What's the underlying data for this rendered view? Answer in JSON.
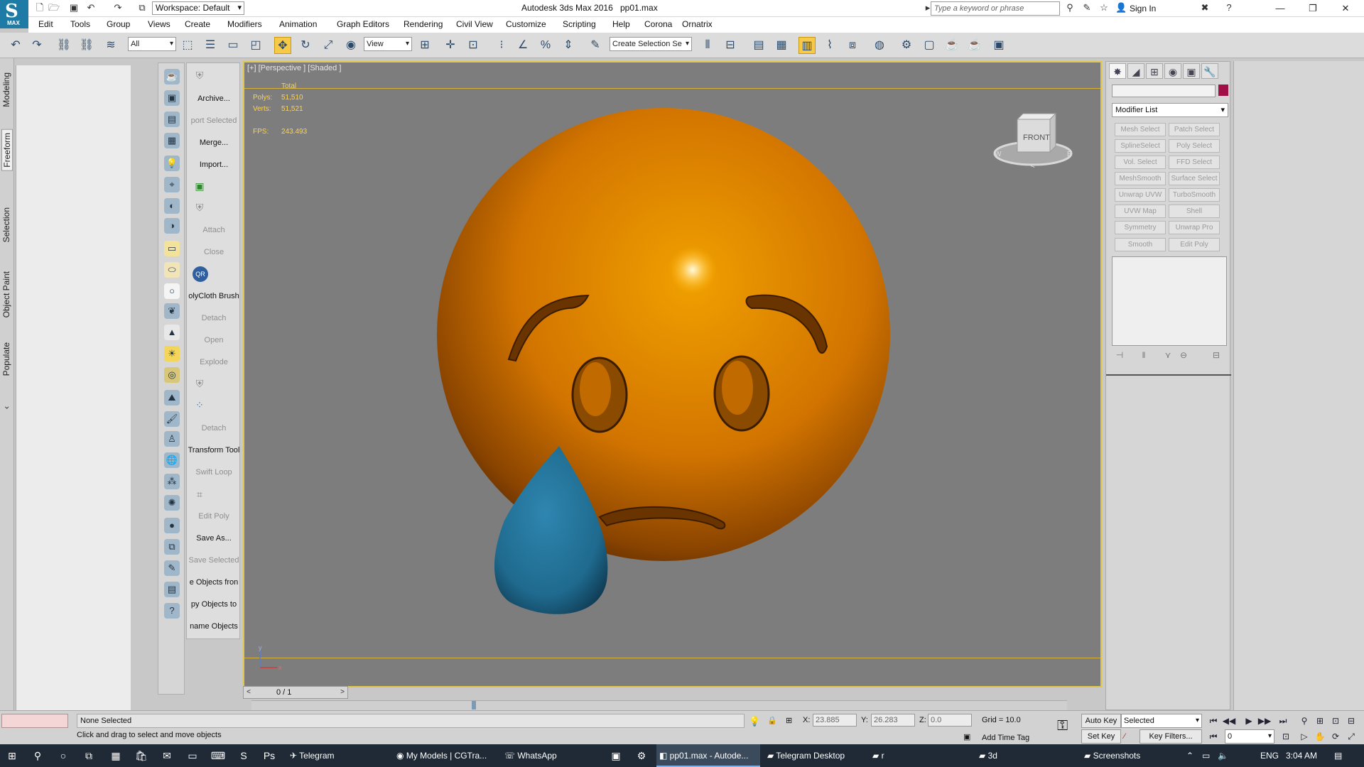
{
  "titlebar": {
    "app_title": "Autodesk 3ds Max 2016",
    "file_name": "pp01.max",
    "workspace": "Workspace: Default",
    "search_placeholder": "Type a keyword or phrase",
    "sign_in": "Sign In",
    "logo_letter": "S",
    "logo_text": "MAX"
  },
  "menu": [
    "Edit",
    "Tools",
    "Group",
    "Views",
    "Create",
    "Modifiers",
    "Animation",
    "Graph Editors",
    "Rendering",
    "Civil View",
    "Customize",
    "Scripting",
    "Help",
    "Corona",
    "Ornatrix"
  ],
  "toolbar": {
    "selection_filter": "All",
    "ref_coord": "View",
    "named_selection": "Create Selection Se"
  },
  "ribbon_tabs": [
    "Modeling",
    "Freeform",
    "Selection",
    "Object Paint",
    "Populate"
  ],
  "ribbon_active": "Freeform",
  "command_panel": {
    "labels": [
      {
        "text": "Archive...",
        "disabled": false
      },
      {
        "text": "port Selected",
        "disabled": true
      },
      {
        "text": "Merge...",
        "disabled": false
      },
      {
        "text": "Import...",
        "disabled": false
      },
      {
        "text": "Attach",
        "disabled": true
      },
      {
        "text": "Close",
        "disabled": true
      },
      {
        "text": "olyCloth Brush",
        "disabled": false
      },
      {
        "text": "Detach",
        "disabled": true
      },
      {
        "text": "Open",
        "disabled": true
      },
      {
        "text": "Explode",
        "disabled": true
      },
      {
        "text": "Detach",
        "disabled": true
      },
      {
        "text": "Transform Tool",
        "disabled": false
      },
      {
        "text": "Swift Loop",
        "disabled": true
      },
      {
        "text": "Edit Poly",
        "disabled": true
      },
      {
        "text": "Save As...",
        "disabled": false
      },
      {
        "text": "Save Selected",
        "disabled": true
      },
      {
        "text": "e Objects fron",
        "disabled": false
      },
      {
        "text": "py Objects to",
        "disabled": false
      },
      {
        "text": "name Objects",
        "disabled": false
      }
    ],
    "qr_text": "QR"
  },
  "viewport": {
    "label": "[+] [Perspective ] [Shaded ]",
    "stats_header": "Total",
    "polys_label": "Polys:",
    "polys": "51,510",
    "verts_label": "Verts:",
    "verts": "51,521",
    "fps_label": "FPS:",
    "fps": "243.493",
    "viewcube_face": "FRONT",
    "viewcube_w": "W",
    "viewcube_s": "S",
    "viewcube_e": "E",
    "axis_y": "y",
    "axis_x": "x",
    "colors": {
      "face": "#d77a00",
      "tear": "#1f6a8e",
      "background": "#7d7d7d"
    }
  },
  "modifier_panel": {
    "list_label": "Modifier List",
    "buttons": [
      "Mesh Select",
      "Patch Select",
      "SplineSelect",
      "Poly Select",
      "Vol. Select",
      "FFD Select",
      "MeshSmooth",
      "Surface Select",
      "Unwrap UVW",
      "TurboSmooth",
      "UVW Map",
      "Shell",
      "Symmetry",
      "Unwrap Pro",
      "Smooth",
      "Edit Poly"
    ]
  },
  "timeslider": {
    "frame": "0 / 1"
  },
  "status": {
    "selection": "None Selected",
    "prompt": "Click and drag to select and move objects",
    "x_label": "X:",
    "x": "23.885",
    "y_label": "Y:",
    "y": "26.283",
    "z_label": "Z:",
    "z": "0.0",
    "grid": "Grid = 10.0",
    "add_time_tag": "Add Time Tag",
    "auto_key": "Auto Key",
    "set_key": "Set Key",
    "key_mode": "Selected",
    "key_filters": "Key Filters...",
    "frame_field": "0"
  },
  "taskbar": {
    "apps": [
      {
        "label": "Telegram",
        "active": false
      },
      {
        "label": "My Models | CGTra...",
        "active": false
      },
      {
        "label": "WhatsApp",
        "active": false
      },
      {
        "label": "pp01.max - Autode...",
        "active": true
      },
      {
        "label": "Telegram Desktop",
        "active": false
      },
      {
        "label": "r",
        "active": false
      },
      {
        "label": "3d",
        "active": false
      },
      {
        "label": "Screenshots",
        "active": false
      }
    ],
    "lang": "ENG",
    "time": "3:04 AM"
  }
}
